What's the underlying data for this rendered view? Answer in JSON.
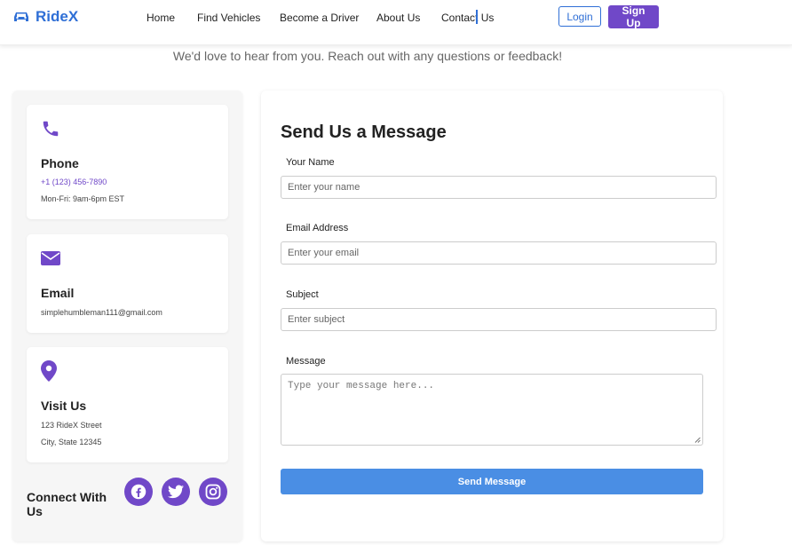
{
  "brand": {
    "name": "RideX",
    "icon": "car-icon",
    "color": "#2f6fd6"
  },
  "nav": {
    "links": [
      "Home",
      "Find Vehicles",
      "Become a Driver",
      "About Us",
      "Contact Us"
    ],
    "login": "Login",
    "signup": "Sign Up"
  },
  "subtitle": "We'd love to hear from you. Reach out with any questions or feedback!",
  "contact": {
    "phone": {
      "icon": "phone-icon",
      "title": "Phone",
      "line1": "+1 (123) 456-7890",
      "line2": "Mon-Fri: 9am-6pm EST"
    },
    "email": {
      "icon": "envelope-icon",
      "title": "Email",
      "line1": "simplehumbleman111@gmail.com"
    },
    "visit": {
      "icon": "map-pin-icon",
      "title": "Visit Us",
      "line1": "123 RideX Street",
      "line2": "City, State 12345"
    },
    "connect_title": "Connect With Us",
    "social": [
      "facebook-icon",
      "twitter-icon",
      "instagram-icon"
    ]
  },
  "form": {
    "title": "Send Us a Message",
    "name_label": "Your Name",
    "name_placeholder": "Enter your name",
    "email_label": "Email Address",
    "email_placeholder": "Enter your email",
    "subject_label": "Subject",
    "subject_placeholder": "Enter subject",
    "message_label": "Message",
    "message_placeholder": "Type your message here...",
    "submit": "Send Message"
  },
  "colors": {
    "accent": "#7048c8",
    "primary": "#2f6fd6",
    "button": "#4a8ee4"
  }
}
